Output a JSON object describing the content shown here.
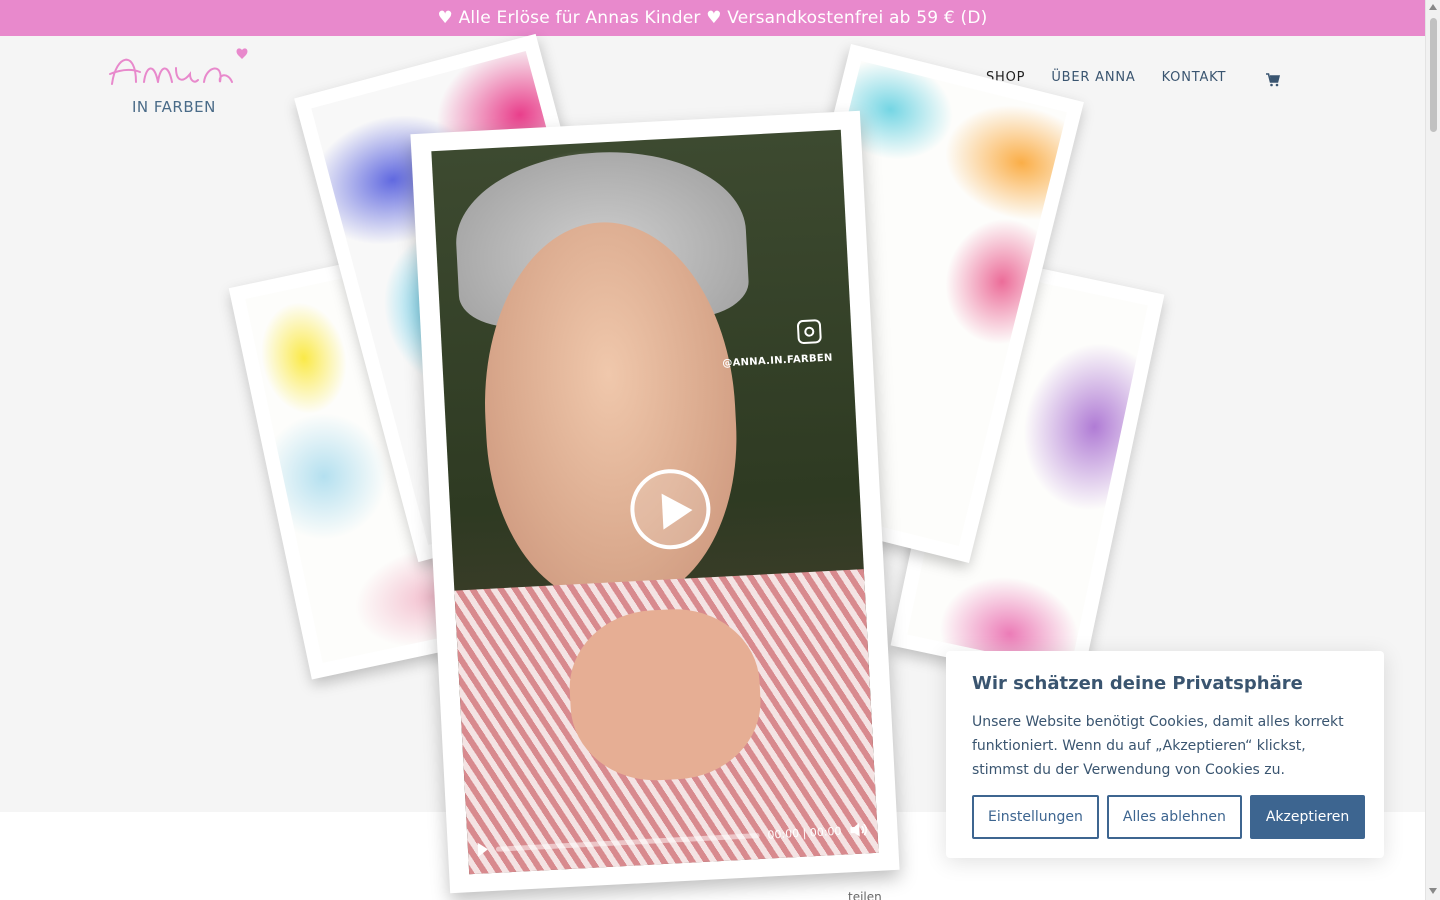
{
  "announcement": {
    "text": "♥ Alle Erlöse für Annas Kinder ♥ Versandkostenfrei ab 59 € (D)"
  },
  "logo": {
    "script": "anna",
    "sub": "IN FARBEN"
  },
  "nav": {
    "shop": "SHOP",
    "about": "ÜBER ANNA",
    "contact": "KONTAKT",
    "active": "SHOP"
  },
  "cart": {
    "icon": "cart-icon"
  },
  "video": {
    "handle": "@ANNA.IN.FARBEN",
    "time": "00:00 | 00:00",
    "progress": 0
  },
  "below_text": "teilen",
  "cookie": {
    "title": "Wir schätzen deine Privatsphäre",
    "body": "Unsere Website benötigt Cookies, damit alles korrekt funktioniert. Wenn du auf „Akzeptieren“ klickst, stimmst du der Verwendung von Cookies zu.",
    "settings": "Einstellungen",
    "reject": "Alles ablehnen",
    "accept": "Akzeptieren"
  },
  "colors": {
    "accent": "#e889cc",
    "primary": "#3d6590",
    "text": "#3a5570"
  }
}
